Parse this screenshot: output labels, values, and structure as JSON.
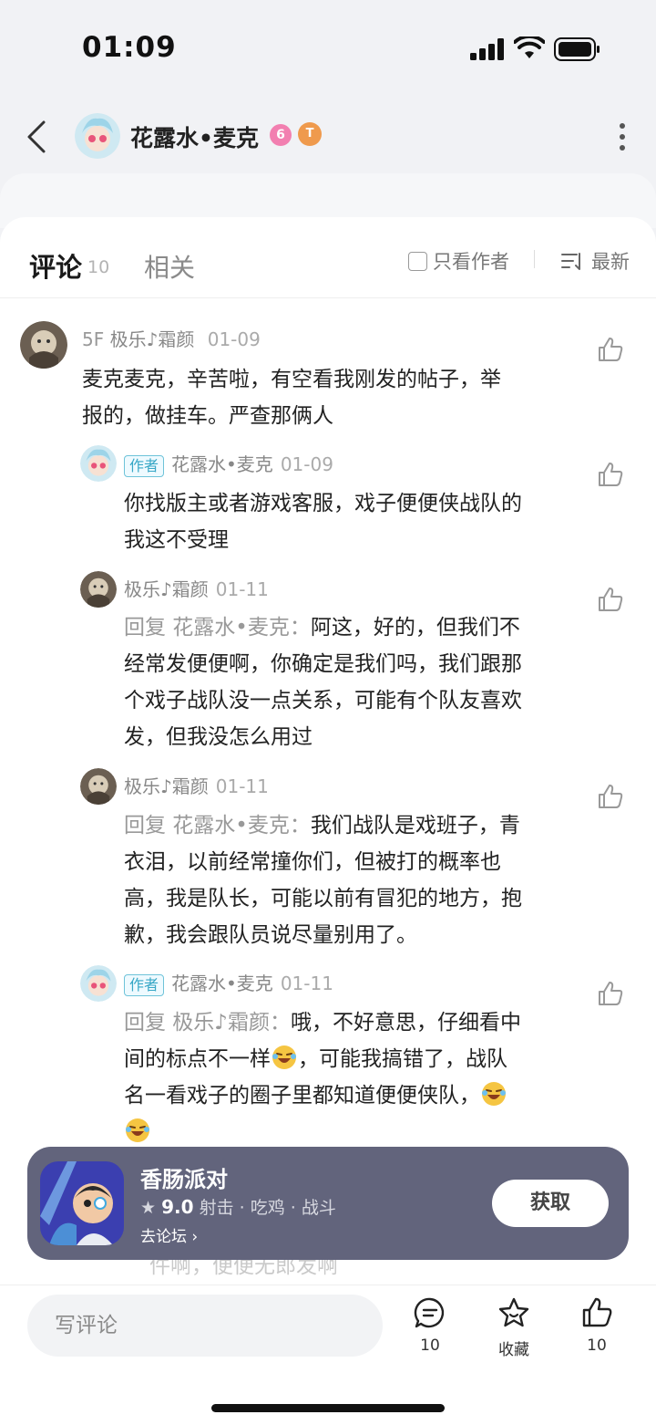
{
  "status": {
    "time": "01:09"
  },
  "header": {
    "name": "花露水•麦克",
    "badge1": "6",
    "badge2": "T"
  },
  "tabs": {
    "comment": "评论",
    "comment_count": "10",
    "related": "相关",
    "author_only": "只看作者",
    "sort": "最新"
  },
  "comments": [
    {
      "floor": "5F",
      "name": "极乐♪霜颜",
      "date": "01-09",
      "text": [
        "麦克麦克，辛苦啦，有空看我刚发的帖子，举",
        "报的，做挂车。严查那俩人"
      ]
    },
    {
      "tag": "作者",
      "name": "花露水•麦克",
      "date": "01-09",
      "text": [
        "你找版主或者游戏客服，戏子便便侠战队的",
        "我这不受理"
      ]
    },
    {
      "name": "极乐♪霜颜",
      "date": "01-11",
      "reply_prefix": "回复 花露水•麦克：",
      "text": [
        "阿这，好的，但我们不",
        "经常发便便啊，你确定是我们吗，我们跟那",
        "个戏子战队没一点关系，可能有个队友喜欢",
        "发，但我没怎么用过"
      ]
    },
    {
      "name": "极乐♪霜颜",
      "date": "01-11",
      "reply_prefix": "回复 花露水•麦克：",
      "text": [
        "我们战队是戏班子，青",
        "衣泪，以前经常撞你们，但被打的概率也",
        "高，我是队长，可能以前有冒犯的地方，抱",
        "歉，我会跟队员说尽量别用了。"
      ]
    },
    {
      "tag": "作者",
      "name": "花露水•麦克",
      "date": "01-11",
      "reply_prefix": "回复 极乐♪霜颜：",
      "text": [
        "哦，不好意思，仔细看中",
        "间的标点不一样",
        "，可能我搞错了，战队",
        "名一看戏子的圈子里都知道便便侠队，"
      ]
    }
  ],
  "game": {
    "title": "香肠派对",
    "rating": "9.0",
    "tags": "射击 · 吃鸡 · 战斗",
    "link": "去论坛",
    "button": "获取"
  },
  "peek": "件啊，便便无郎发啊",
  "bottom": {
    "placeholder": "写评论",
    "comment_count": "10",
    "collect": "收藏",
    "like_count": "10"
  }
}
